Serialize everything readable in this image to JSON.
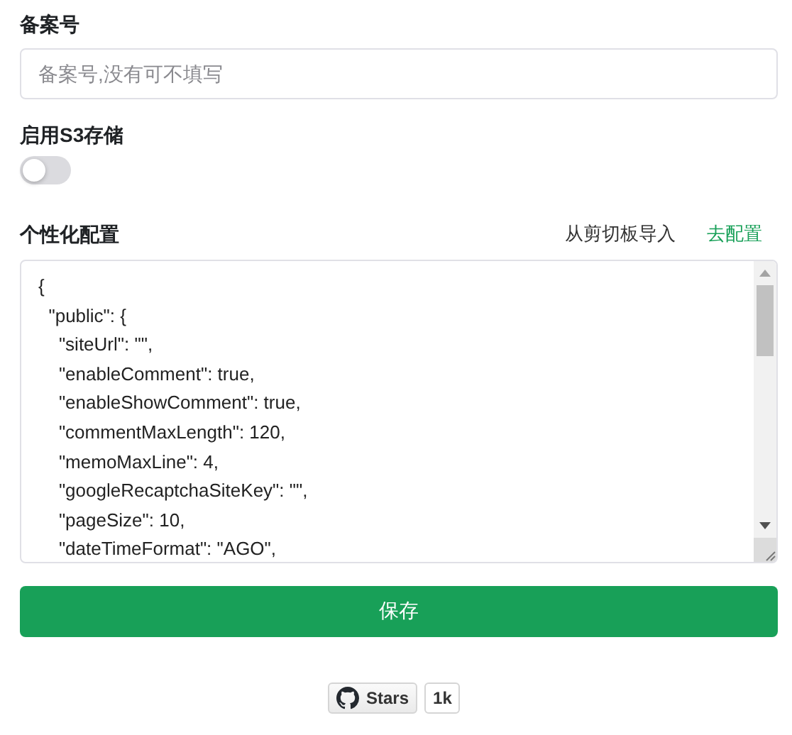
{
  "fields": [
    {
      "kind": "input",
      "label": "备案号",
      "placeholder": "备案号,没有可不填写"
    },
    {
      "kind": "switch",
      "label": "启用S3存储",
      "on": false
    }
  ],
  "config": {
    "label": "个性化配置",
    "actions": [
      {
        "label": "从剪切板导入",
        "kind": "plain"
      },
      {
        "label": "去配置",
        "kind": "link"
      }
    ],
    "lines": [
      "{",
      "  \"public\": {",
      "    \"siteUrl\": \"\",",
      "    \"enableComment\": true,",
      "    \"enableShowComment\": true,",
      "    \"commentMaxLength\": 120,",
      "    \"memoMaxLine\": 4,",
      "    \"googleRecaptchaSiteKey\": \"\",",
      "    \"pageSize\": 10,",
      "    \"dateTimeFormat\": \"AGO\","
    ]
  },
  "save_button": "保存",
  "github": {
    "label": "Stars",
    "count": "1k"
  }
}
